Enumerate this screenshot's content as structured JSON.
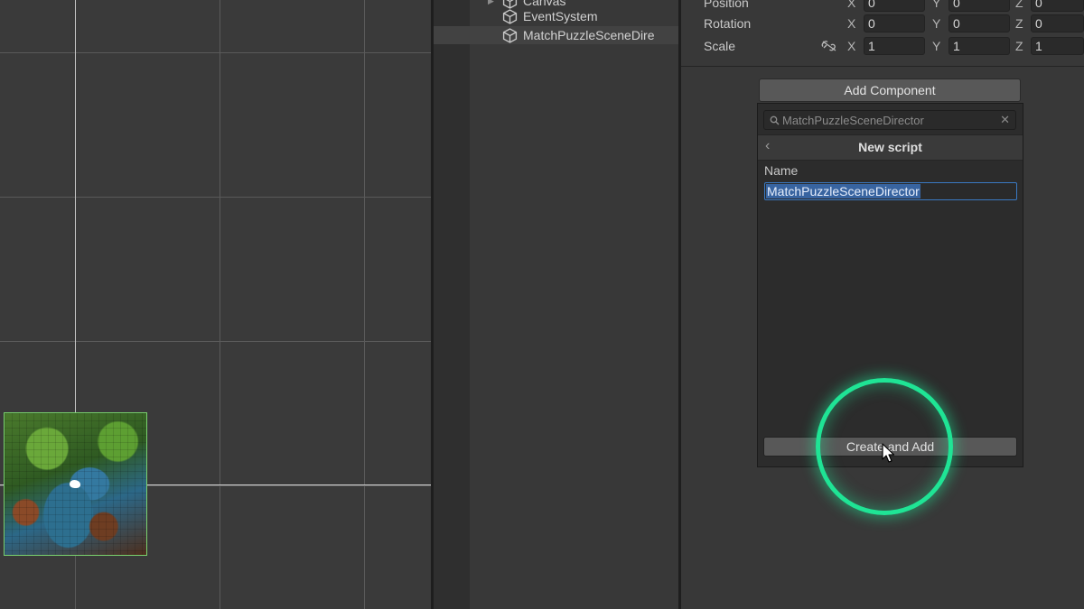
{
  "hierarchy": {
    "items": [
      {
        "label": "Canvas",
        "selected": false
      },
      {
        "label": "EventSystem",
        "selected": false
      },
      {
        "label": "MatchPuzzleSceneDire",
        "selected": true
      }
    ]
  },
  "inspector": {
    "transform": {
      "position": {
        "label": "Position",
        "x": "0",
        "y": "0",
        "z": "0"
      },
      "rotation": {
        "label": "Rotation",
        "x": "0",
        "y": "0",
        "z": "0"
      },
      "scale": {
        "label": "Scale",
        "x": "1",
        "y": "1",
        "z": "1"
      },
      "axis_labels": {
        "x": "X",
        "y": "Y",
        "z": "Z"
      }
    },
    "add_component_label": "Add Component",
    "popup": {
      "search_value": "MatchPuzzleSceneDirector",
      "header_title": "New script",
      "name_label": "Name",
      "name_value": "MatchPuzzleSceneDirector",
      "create_button_label": "Create and Add"
    }
  },
  "colors": {
    "highlight_ring": "#1fe495",
    "selection": "#3864a0",
    "panel_bg": "#383838"
  }
}
